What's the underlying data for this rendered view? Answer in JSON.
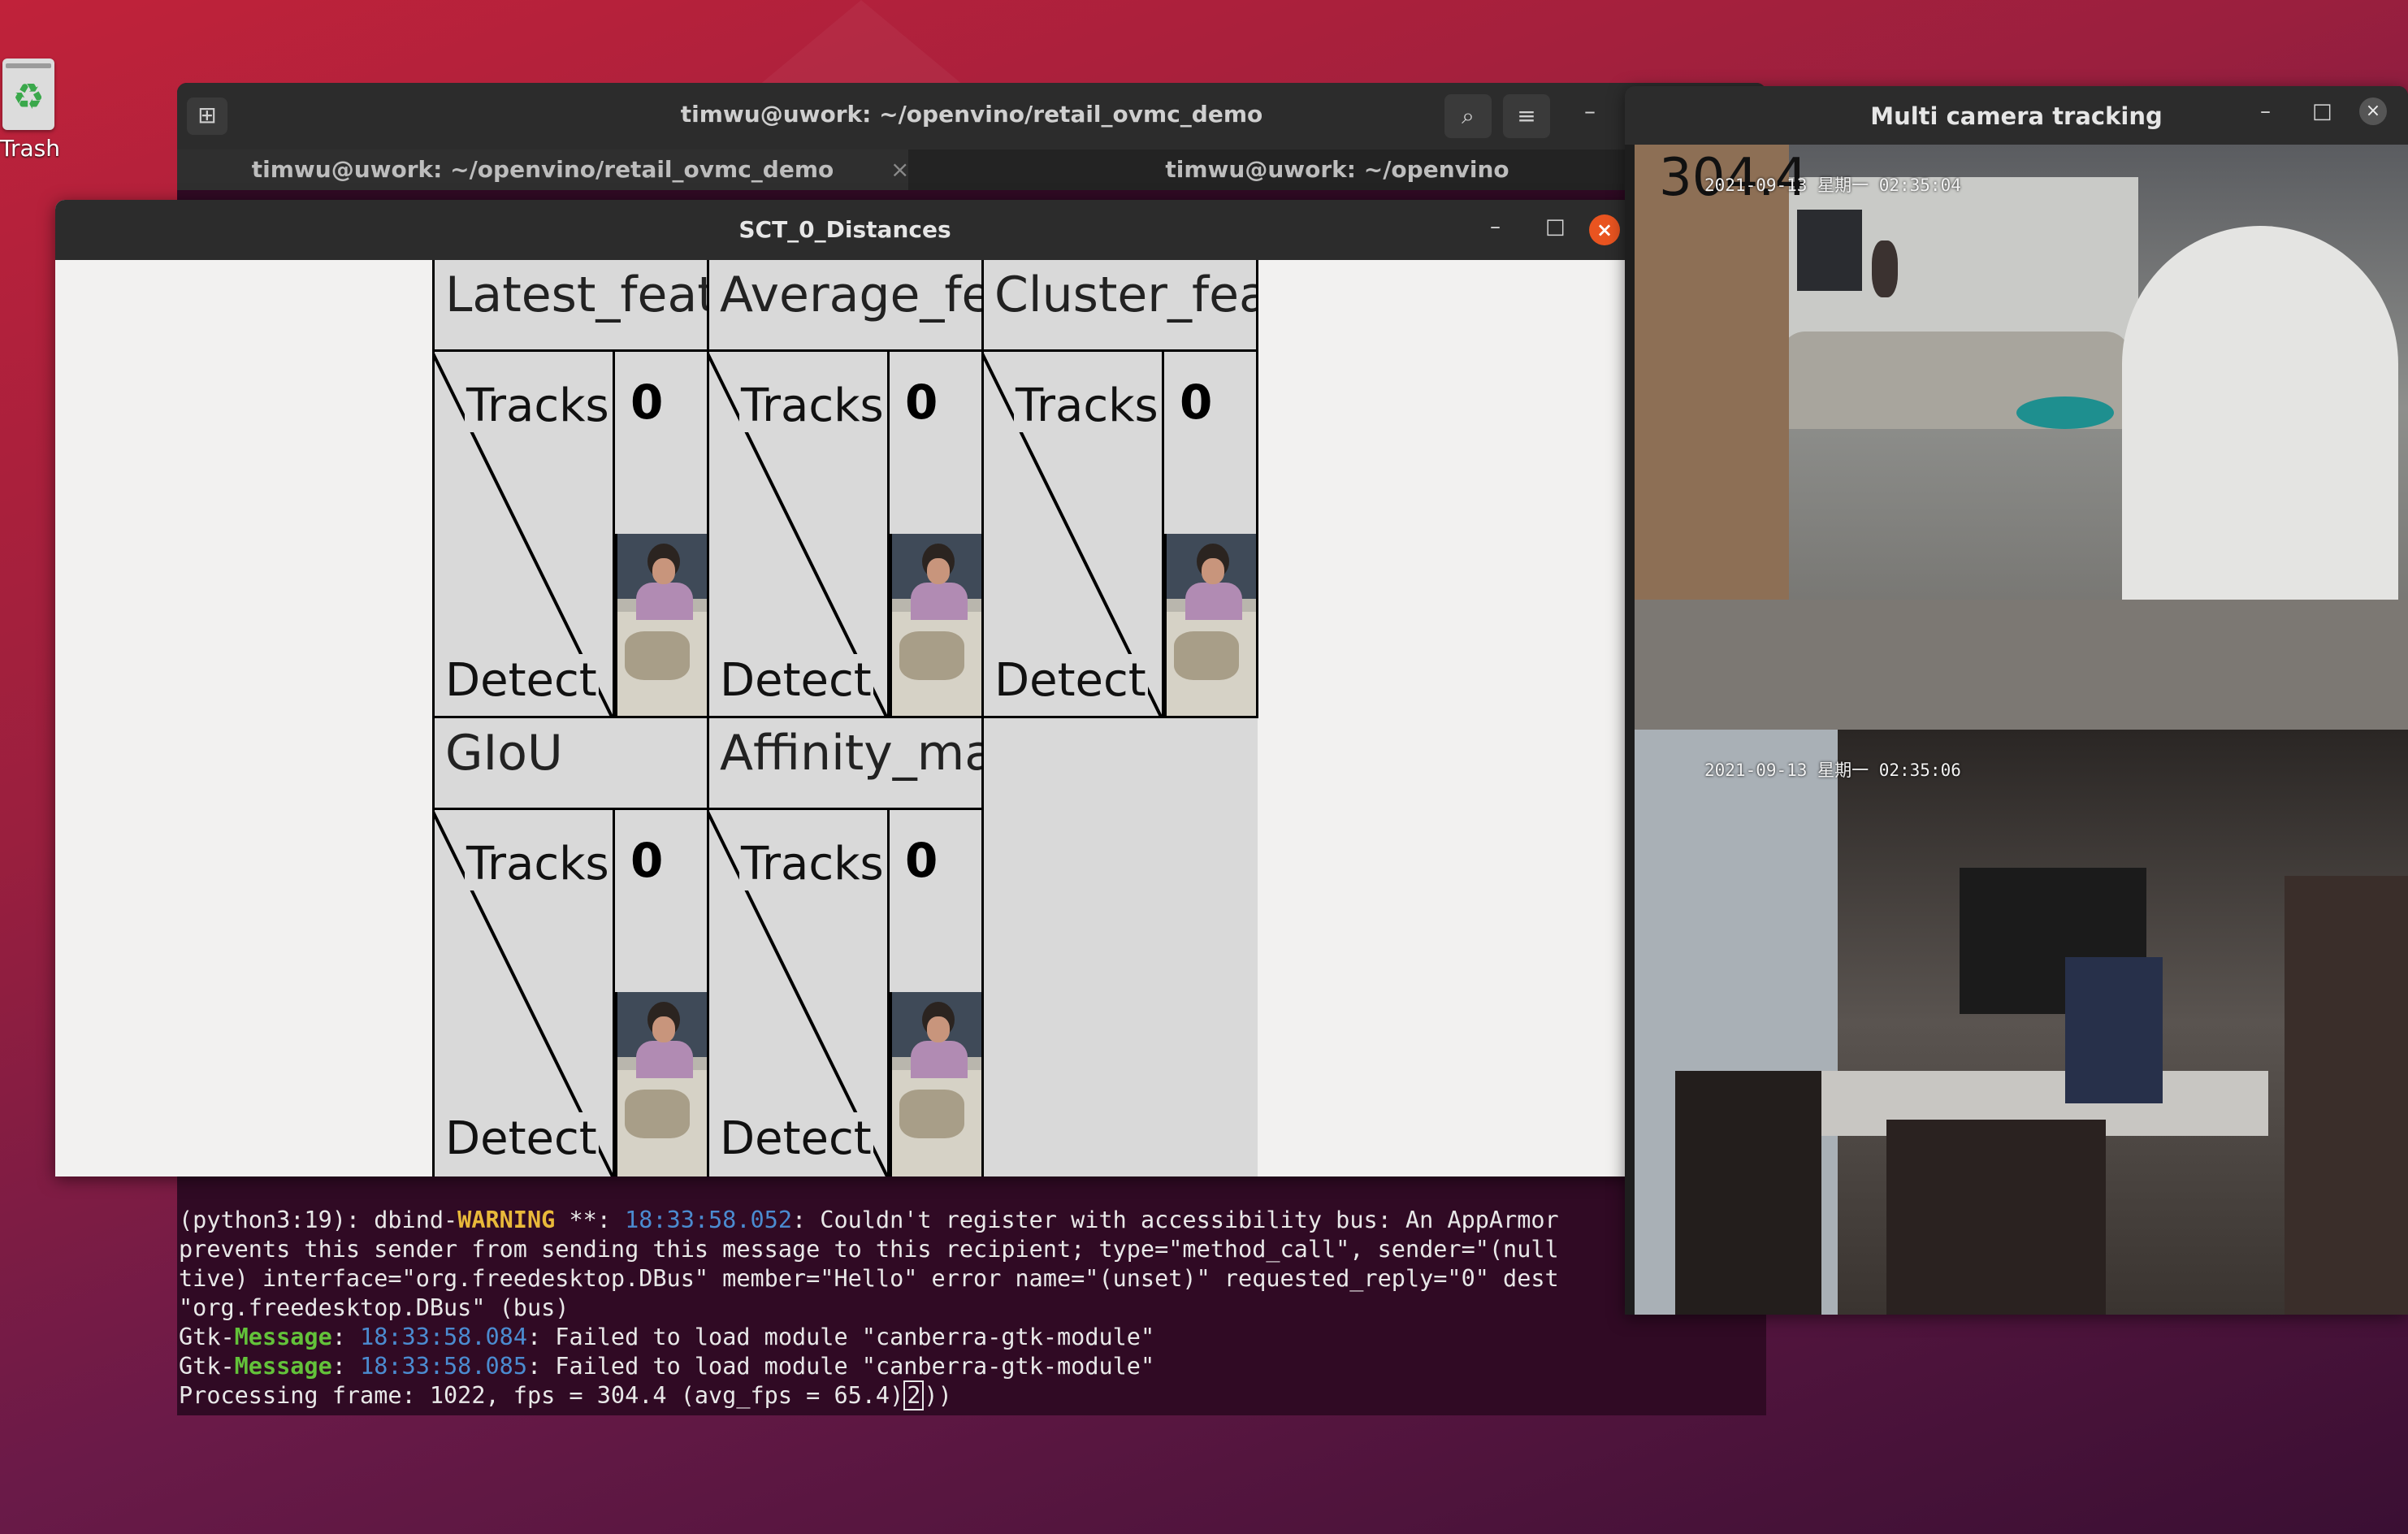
{
  "desktop": {
    "trash_label": "Trash"
  },
  "terminal": {
    "title": "timwu@uwork: ~/openvino/retail_ovmc_demo",
    "tabs": [
      {
        "label": "timwu@uwork: ~/openvino/retail_ovmc_demo"
      },
      {
        "label": "timwu@uwork: ~/openvino"
      }
    ],
    "tab_close": "×",
    "output": {
      "line1_prefix": "(python3:19): dbind-",
      "line1_warn": "WARNING",
      "line1_mid": " **: ",
      "line1_ts": "18:33:58.052",
      "line1_rest": ": Couldn't register with accessibility bus: An AppArmor",
      "line2": "prevents this sender from sending this message to this recipient; type=\"method_call\", sender=\"(null",
      "line3": "tive) interface=\"org.freedesktop.DBus\" member=\"Hello\" error name=\"(unset)\" requested_reply=\"0\" dest",
      "line4": "\"org.freedesktop.DBus\" (bus)",
      "line5_prefix": "Gtk-",
      "line5_msg": "Message",
      "line5_ts": "18:33:58.084",
      "line5_rest": ": Failed to load module \"canberra-gtk-module\"",
      "line6_prefix": "Gtk-",
      "line6_msg": "Message",
      "line6_ts": "18:33:58.085",
      "line6_rest": ": Failed to load module \"canberra-gtk-module\"",
      "line7_text": "Processing frame: 1022, fps = 304.4 (avg_fps = 65.4)",
      "line7_cursor": "2",
      "line7_tail": "))"
    }
  },
  "sct_window": {
    "title": "SCT_0_Distances",
    "panels": [
      {
        "title": "Latest_feature",
        "tracks_label": "Tracks",
        "detect_label": "Detect",
        "value": "0"
      },
      {
        "title": "Average_feature",
        "tracks_label": "Tracks",
        "detect_label": "Detect",
        "value": "0"
      },
      {
        "title": "Cluster_feature",
        "tracks_label": "Tracks",
        "detect_label": "Detect",
        "value": "0"
      },
      {
        "title": "GIoU",
        "tracks_label": "Tracks",
        "detect_label": "Detect",
        "value": "0"
      },
      {
        "title": "Affinity_matrix",
        "tracks_label": "Tracks",
        "detect_label": "Detect",
        "value": "0"
      }
    ]
  },
  "mct_window": {
    "title": "Multi camera tracking",
    "fps_overlay": "304.4",
    "cam1_timestamp": "2021-09-13 星期一 02:35:04",
    "cam2_timestamp": "2021-09-13 星期一 02:35:06"
  },
  "colors": {
    "ubuntu_orange": "#e95420",
    "terminal_bg": "#300a24",
    "warning": "#e9b93a",
    "timestamp": "#4b8bd0",
    "message": "#63c23a"
  }
}
